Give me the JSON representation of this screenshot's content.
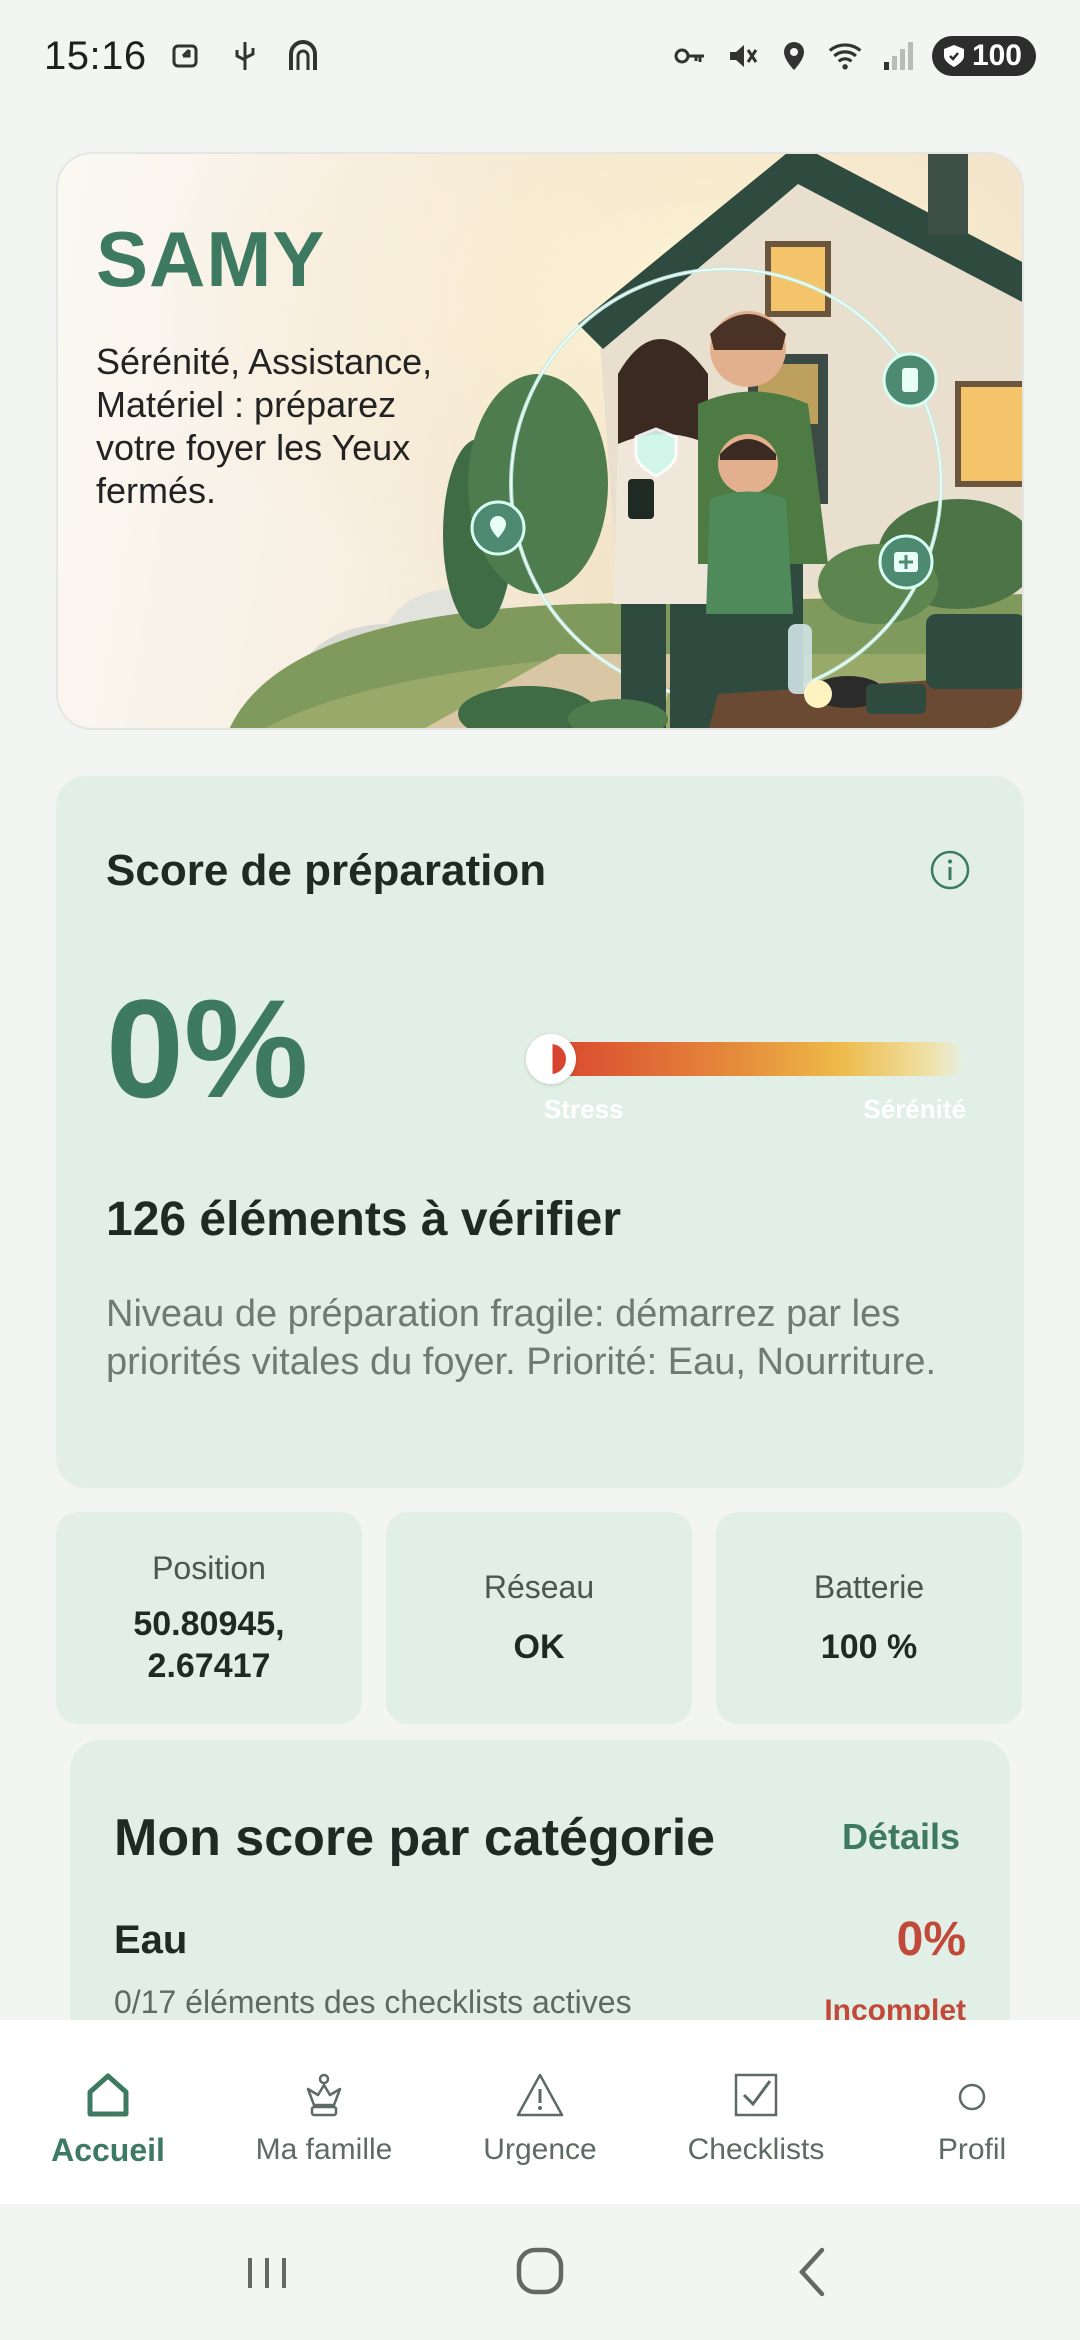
{
  "status_bar": {
    "time": "15:16",
    "battery": "100"
  },
  "hero": {
    "title": "SAMY",
    "subtitle": "Sérénité, Assistance, Matériel : préparez votre foyer les Yeux fermés."
  },
  "score": {
    "title": "Score de préparation",
    "percent": "0%",
    "gauge_left": "Stress",
    "gauge_right": "Sérénité",
    "gauge_fraction": 0.0,
    "count": "126 éléments à vérifier",
    "description": "Niveau de préparation fragile: démarrez par les priorités vitales du foyer. Priorité: Eau, Nourriture."
  },
  "tiles": {
    "position_label": "Position",
    "position_value": "50.80945,\n2.67417",
    "network_label": "Réseau",
    "network_value": "OK",
    "battery_label": "Batterie",
    "battery_value": "100 %"
  },
  "categories": {
    "title": "Mon score par catégorie",
    "details": "Détails",
    "items": [
      {
        "name": "Eau",
        "sub": "0/17 éléments des checklists actives",
        "percent": "0%",
        "status": "Incomplet"
      }
    ]
  },
  "nav": {
    "items": [
      {
        "label": "Accueil",
        "icon": "home-icon"
      },
      {
        "label": "Ma famille",
        "icon": "crown-icon"
      },
      {
        "label": "Urgence",
        "icon": "warning-icon"
      },
      {
        "label": "Checklists",
        "icon": "checkbox-icon"
      },
      {
        "label": "Profil",
        "icon": "circle-icon"
      }
    ]
  },
  "colors": {
    "accent": "#3d7a61",
    "card_bg": "#e1efe6",
    "danger": "#c0493a"
  }
}
